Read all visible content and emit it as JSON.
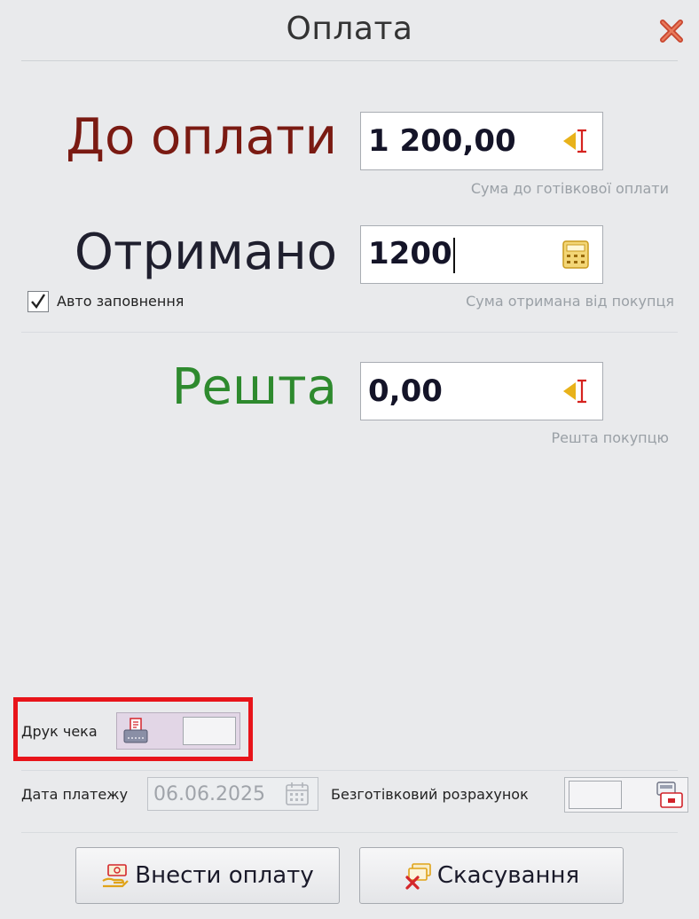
{
  "window": {
    "title": "Оплата"
  },
  "amount_due": {
    "label": "До оплати",
    "value": "1 200,00",
    "hint": "Сума до готівкової оплати",
    "icon": "cursor-insert-icon",
    "color": "#7a1a12"
  },
  "received": {
    "label": "Отримано",
    "value": "1200",
    "hint": "Сума отримана від покупця",
    "icon": "calculator-icon",
    "color": "#1f1f2e"
  },
  "autofill": {
    "label": "Авто заповнення",
    "checked": true
  },
  "change": {
    "label": "Решта",
    "value": "0,00",
    "hint": "Решта покупцю",
    "icon": "cursor-insert-icon",
    "color": "#2e8a2e"
  },
  "print_receipt": {
    "label": "Друк чека",
    "icon": "receipt-printer-icon"
  },
  "payment_date": {
    "label": "Дата платежу",
    "value": "06.06.2025",
    "icon": "calendar-icon"
  },
  "cashless": {
    "label": "Безготівковий розрахунок",
    "icon": "card-terminal-icon"
  },
  "buttons": {
    "submit": {
      "label": "Внести оплату",
      "icon": "money-hand-icon"
    },
    "cancel": {
      "label": "Скасування",
      "icon": "cancel-payment-icon"
    }
  },
  "colors": {
    "highlight": "#e8141a",
    "accent_green": "#2e8a2e",
    "accent_red": "#7a1a12"
  }
}
